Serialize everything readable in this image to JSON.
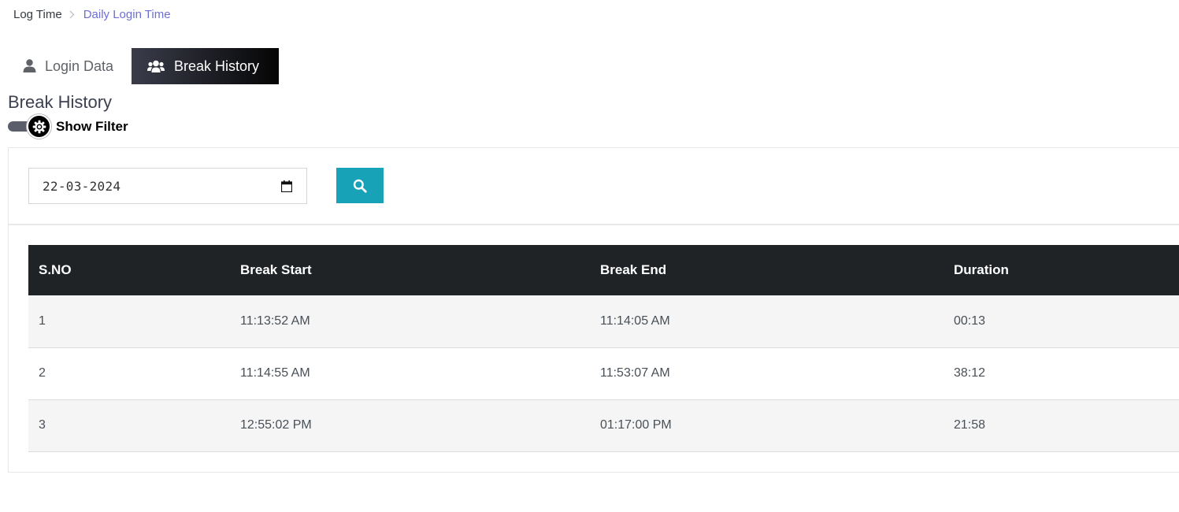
{
  "breadcrumb": {
    "root": "Log Time",
    "current": "Daily Login Time",
    "separator_icon": "chevron-right-icon"
  },
  "tabs": [
    {
      "label": "Login Data",
      "icon": "user-icon",
      "active": false
    },
    {
      "label": "Break History",
      "icon": "users-icon",
      "active": true
    }
  ],
  "section": {
    "title": "Break History"
  },
  "filter": {
    "toggle_label": "Show Filter",
    "toggle_icon": "gear-icon",
    "toggle_on": true
  },
  "search": {
    "date_value": "22-03-2024",
    "date_icon": "calendar-icon",
    "button_icon": "search-icon"
  },
  "table": {
    "headers": [
      "S.NO",
      "Break Start",
      "Break End",
      "Duration"
    ],
    "rows": [
      [
        "1",
        "11:13:52 AM",
        "11:14:05 AM",
        "00:13"
      ],
      [
        "2",
        "11:14:55 AM",
        "11:53:07 AM",
        "38:12"
      ],
      [
        "3",
        "12:55:02 PM",
        "01:17:00 PM",
        "21:58"
      ]
    ]
  },
  "colors": {
    "accent_link": "#6c6fd6",
    "search_button": "#17a2b8",
    "table_header_bg": "#1f2326",
    "active_tab_bg": "#050505"
  }
}
